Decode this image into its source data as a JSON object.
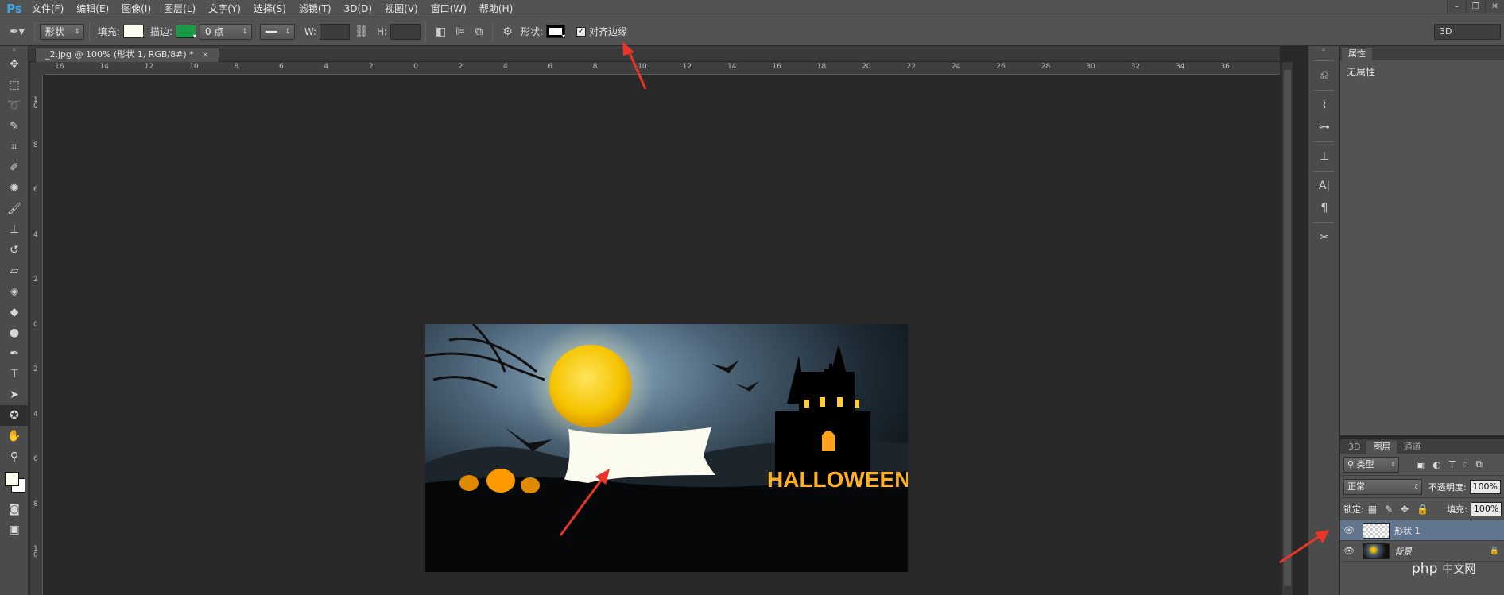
{
  "app": {
    "logo": "Ps"
  },
  "menu": [
    "文件(F)",
    "编辑(E)",
    "图像(I)",
    "图层(L)",
    "文字(Y)",
    "选择(S)",
    "滤镜(T)",
    "3D(D)",
    "视图(V)",
    "窗口(W)",
    "帮助(H)"
  ],
  "window_controls": {
    "minimize": "–",
    "restore": "❐",
    "close": "✕"
  },
  "options": {
    "mode": "形状",
    "fill_label": "填充:",
    "fill_color": "#fbfbef",
    "stroke_label": "描边:",
    "stroke_color": "#1a9a45",
    "stroke_width": "0 点",
    "w_label": "W:",
    "h_label": "H:",
    "shape_label": "形状:",
    "align_edges_label": "对齐边缘",
    "align_edges_checked": true,
    "workspace": "3D"
  },
  "document_tab": {
    "title": "_2.jpg @ 100% (形状 1, RGB/8#) *",
    "close": "×"
  },
  "ruler_h": [
    "16",
    "14",
    "12",
    "10",
    "8",
    "6",
    "4",
    "2",
    "0",
    "2",
    "4",
    "6",
    "8",
    "10",
    "12",
    "14",
    "16",
    "18",
    "20",
    "22",
    "24",
    "26",
    "28",
    "30",
    "32",
    "34",
    "36"
  ],
  "ruler_v": [
    "1 0",
    "8",
    "6",
    "4",
    "2",
    "0",
    "2",
    "4",
    "6",
    "8",
    "1 0"
  ],
  "image": {
    "halloween_text": "HALLOWEEN"
  },
  "properties_panel": {
    "tab": "属性",
    "message": "无属性"
  },
  "layers_panel": {
    "tabs": [
      "3D",
      "图层",
      "通道"
    ],
    "active_tab": "图层",
    "filter_kind": "类型",
    "blend_mode": "正常",
    "opacity_label": "不透明度:",
    "opacity_value": "100%",
    "lock_label": "锁定:",
    "fill_label": "填充:",
    "fill_value": "100%",
    "layers": [
      {
        "name": "形状 1",
        "selected": true
      },
      {
        "name": "背景",
        "locked": true
      }
    ]
  },
  "watermark": {
    "logo": "php",
    "text": "中文网"
  },
  "colors": {
    "accent": "#3fa7e8",
    "selection": "#62758e",
    "arrow": "#e8352a",
    "moon": "#f5c400"
  }
}
